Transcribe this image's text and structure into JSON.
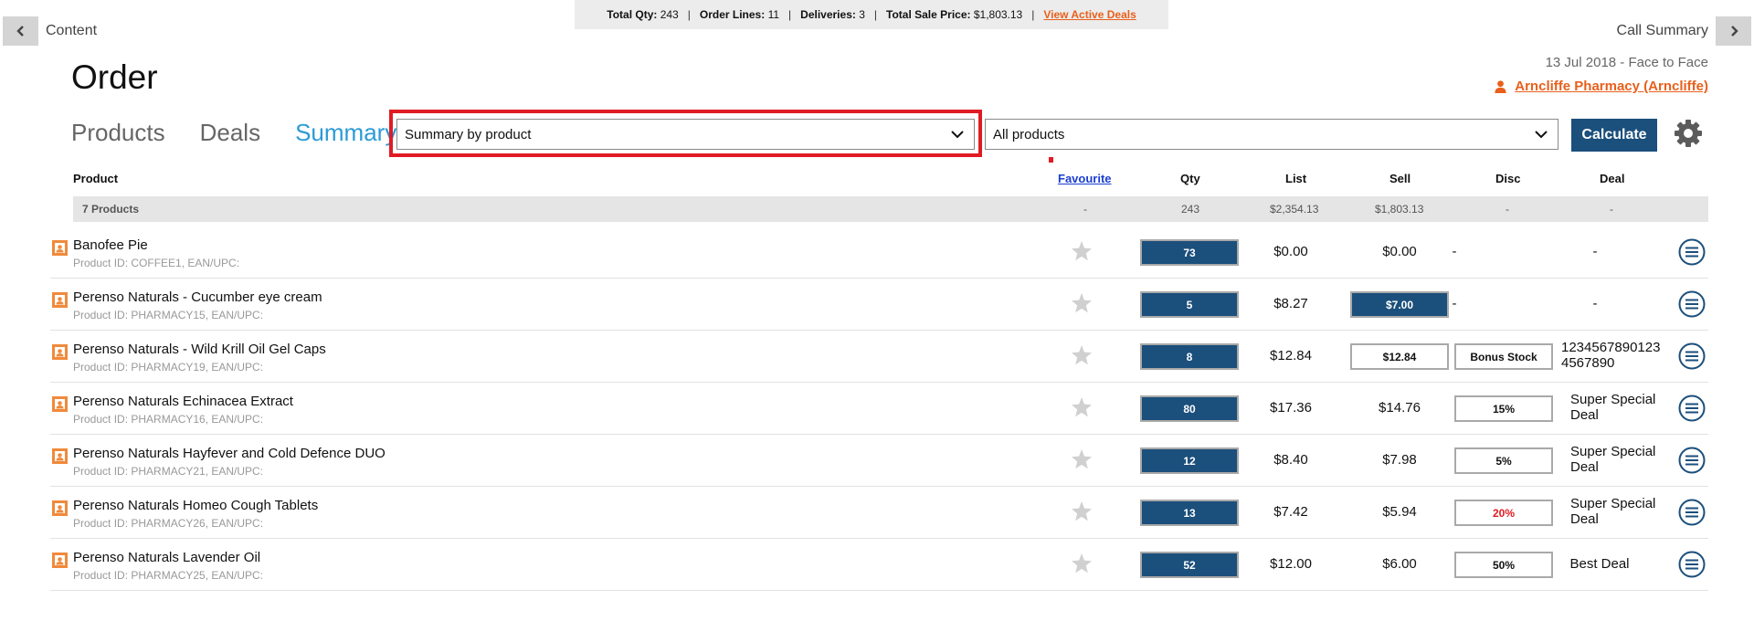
{
  "status_bar": {
    "total_qty_label": "Total Qty:",
    "total_qty": "243",
    "order_lines_label": "Order Lines:",
    "order_lines": "11",
    "deliveries_label": "Deliveries:",
    "deliveries": "3",
    "total_sale_label": "Total Sale Price:",
    "total_sale": "$1,803.13",
    "deals_link": "View Active Deals"
  },
  "nav": {
    "back_label": "Content",
    "forward_label": "Call Summary"
  },
  "page": {
    "title": "Order",
    "call_info": "13 Jul 2018  -  Face to Face",
    "customer": "Arncliffe Pharmacy (Arncliffe)"
  },
  "tabs": [
    {
      "label": "Products"
    },
    {
      "label": "Deals"
    },
    {
      "label": "Summary"
    }
  ],
  "filters": {
    "summary_view": "Summary by product",
    "product_filter": "All products",
    "calculate_label": "Calculate"
  },
  "table": {
    "headers": {
      "product": "Product",
      "favourite": "Favourite",
      "qty": "Qty",
      "list": "List",
      "sell": "Sell",
      "disc": "Disc",
      "deal": "Deal"
    },
    "summary": {
      "label": "7 Products",
      "favourite": "-",
      "qty": "243",
      "list": "$2,354.13",
      "sell": "$1,803.13",
      "disc": "-",
      "deal": "-"
    },
    "rows": [
      {
        "name": "Banofee Pie",
        "pid": "Product ID: COFFEE1, EAN/UPC:",
        "qty": "73",
        "list": "$0.00",
        "sell": "$0.00",
        "disc": "-",
        "deal": "-"
      },
      {
        "name": "Perenso Naturals - Cucumber eye cream",
        "pid": "Product ID: PHARMACY15, EAN/UPC:",
        "qty": "5",
        "list": "$8.27",
        "sell": "$7.00",
        "disc": "-",
        "deal": "-"
      },
      {
        "name": "Perenso Naturals - Wild Krill Oil Gel Caps",
        "pid": "Product ID: PHARMACY19, EAN/UPC:",
        "qty": "8",
        "list": "$12.84",
        "sell": "$12.84",
        "disc": "Bonus Stock",
        "deal": "12345678901234567890"
      },
      {
        "name": "Perenso Naturals Echinacea Extract",
        "pid": "Product ID: PHARMACY16, EAN/UPC:",
        "qty": "80",
        "list": "$17.36",
        "sell": "$14.76",
        "disc": "15%",
        "deal": "Super Special Deal"
      },
      {
        "name": "Perenso Naturals Hayfever and Cold Defence DUO",
        "pid": "Product ID: PHARMACY21, EAN/UPC:",
        "qty": "12",
        "list": "$8.40",
        "sell": "$7.98",
        "disc": "5%",
        "deal": "Super Special Deal"
      },
      {
        "name": "Perenso Naturals Homeo Cough Tablets",
        "pid": "Product ID: PHARMACY26, EAN/UPC:",
        "qty": "13",
        "list": "$7.42",
        "sell": "$5.94",
        "disc": "20%",
        "deal": "Super Special Deal"
      },
      {
        "name": "Perenso Naturals Lavender Oil",
        "pid": "Product ID: PHARMACY25, EAN/UPC:",
        "qty": "52",
        "list": "$12.00",
        "sell": "$6.00",
        "disc": "50%",
        "deal": "Best Deal"
      }
    ]
  },
  "colors": {
    "accent_blue": "#1b4f7c",
    "link_orange": "#e8601c",
    "active_tab": "#2b9bd6",
    "highlight_red": "#e01b24"
  },
  "icons": {
    "back": "chevron-left-icon",
    "forward": "chevron-right-icon",
    "customer": "person-icon",
    "dropdown": "chevron-down-icon",
    "settings": "gear-icon",
    "favourite": "star-icon",
    "product_image": "image-placeholder-icon",
    "row_menu": "hamburger-menu-icon"
  }
}
